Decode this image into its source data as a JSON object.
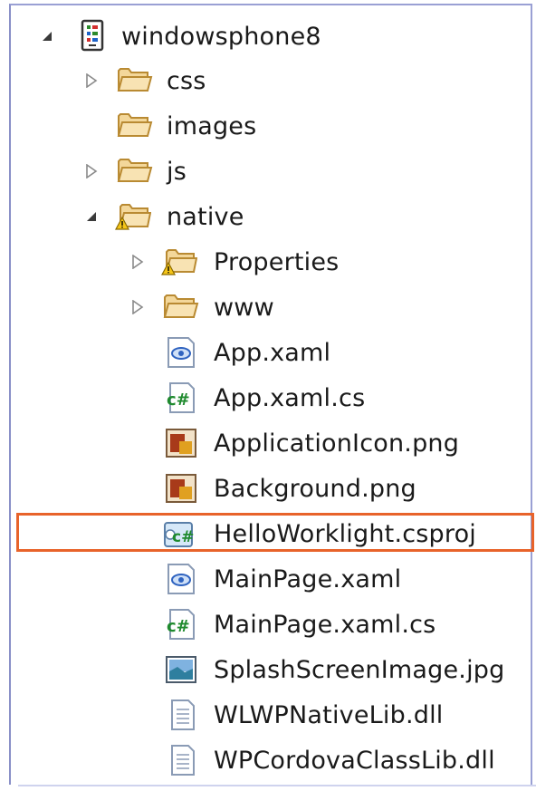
{
  "tree": {
    "root": {
      "label": "windowsphone8",
      "icon": "project-icon",
      "expanded": true
    },
    "items": [
      {
        "label": "css",
        "icon": "folder-icon",
        "toggle": "collapsed"
      },
      {
        "label": "images",
        "icon": "folder-icon",
        "toggle": "none"
      },
      {
        "label": "js",
        "icon": "folder-icon",
        "toggle": "collapsed"
      },
      {
        "label": "native",
        "icon": "folder-warning-icon",
        "toggle": "expanded"
      },
      {
        "label": "Properties",
        "icon": "folder-warning-icon",
        "toggle": "collapsed"
      },
      {
        "label": "www",
        "icon": "folder-icon",
        "toggle": "collapsed"
      },
      {
        "label": "App.xaml",
        "icon": "xaml-file-icon",
        "toggle": "none"
      },
      {
        "label": "App.xaml.cs",
        "icon": "csharp-file-icon",
        "toggle": "none"
      },
      {
        "label": "ApplicationIcon.png",
        "icon": "png-image-icon",
        "toggle": "none"
      },
      {
        "label": "Background.png",
        "icon": "png-image-icon",
        "toggle": "none"
      },
      {
        "label": "HelloWorklight.csproj",
        "icon": "csproj-file-icon",
        "toggle": "none",
        "selected": true
      },
      {
        "label": "MainPage.xaml",
        "icon": "xaml-file-icon",
        "toggle": "none"
      },
      {
        "label": "MainPage.xaml.cs",
        "icon": "csharp-file-icon",
        "toggle": "none"
      },
      {
        "label": "SplashScreenImage.jpg",
        "icon": "jpg-image-icon",
        "toggle": "none"
      },
      {
        "label": "WLWPNativeLib.dll",
        "icon": "dll-file-icon",
        "toggle": "none"
      },
      {
        "label": "WPCordovaClassLib.dll",
        "icon": "dll-file-icon",
        "toggle": "none"
      }
    ]
  },
  "colors": {
    "highlight_border": "#e8632a",
    "frame_border": "#9aa0d4",
    "folder_fill": "#f3d79a",
    "folder_stroke": "#b98a32"
  }
}
